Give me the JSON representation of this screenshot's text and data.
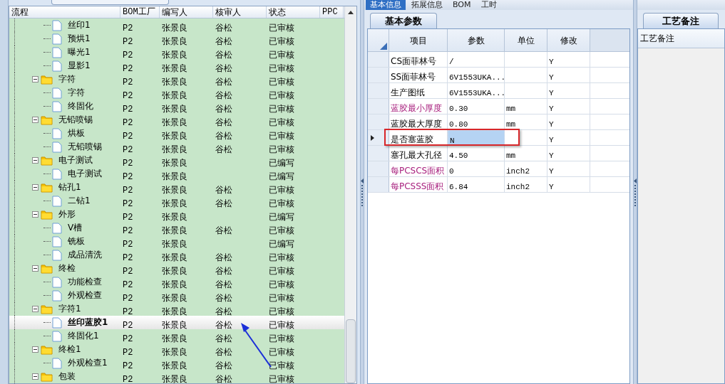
{
  "left_panel": {
    "columns": [
      "流程",
      "BOM工厂",
      "编写人",
      "核审人",
      "状态",
      "PPC"
    ],
    "rows": [
      {
        "kind": "leaf",
        "name": "丝印1",
        "bom": "P2",
        "writer": "张景良",
        "reviewer": "谷松",
        "status": "已审核",
        "selected": false
      },
      {
        "kind": "leaf",
        "name": "预烘1",
        "bom": "P2",
        "writer": "张景良",
        "reviewer": "谷松",
        "status": "已审核",
        "selected": false
      },
      {
        "kind": "leaf",
        "name": "曝光1",
        "bom": "P2",
        "writer": "张景良",
        "reviewer": "谷松",
        "status": "已审核",
        "selected": false
      },
      {
        "kind": "leaf",
        "name": "显影1",
        "bom": "P2",
        "writer": "张景良",
        "reviewer": "谷松",
        "status": "已审核",
        "selected": false
      },
      {
        "kind": "folder",
        "name": "字符",
        "bom": "P2",
        "writer": "张景良",
        "reviewer": "谷松",
        "status": "已审核",
        "selected": false,
        "expanded": true,
        "children": [
          {
            "kind": "leaf",
            "name": "字符",
            "bom": "P2",
            "writer": "张景良",
            "reviewer": "谷松",
            "status": "已审核",
            "selected": false
          },
          {
            "kind": "leaf",
            "name": "终固化",
            "bom": "P2",
            "writer": "张景良",
            "reviewer": "谷松",
            "status": "已审核",
            "selected": false
          }
        ]
      },
      {
        "kind": "folder",
        "name": "无铅喷锡",
        "bom": "P2",
        "writer": "张景良",
        "reviewer": "谷松",
        "status": "已审核",
        "selected": false,
        "expanded": true,
        "children": [
          {
            "kind": "leaf",
            "name": "烘板",
            "bom": "P2",
            "writer": "张景良",
            "reviewer": "谷松",
            "status": "已审核",
            "selected": false
          },
          {
            "kind": "leaf",
            "name": "无铅喷锡",
            "bom": "P2",
            "writer": "张景良",
            "reviewer": "谷松",
            "status": "已审核",
            "selected": false
          }
        ]
      },
      {
        "kind": "folder",
        "name": "电子测试",
        "bom": "P2",
        "writer": "张景良",
        "status": "已编写",
        "selected": false,
        "expanded": true,
        "children": [
          {
            "kind": "leaf",
            "name": "电子测试",
            "bom": "P2",
            "writer": "张景良",
            "status": "已编写",
            "selected": false
          }
        ]
      },
      {
        "kind": "folder",
        "name": "钻孔1",
        "bom": "P2",
        "writer": "张景良",
        "reviewer": "谷松",
        "status": "已审核",
        "selected": false,
        "expanded": true,
        "children": [
          {
            "kind": "leaf",
            "name": "二钻1",
            "bom": "P2",
            "writer": "张景良",
            "reviewer": "谷松",
            "status": "已审核",
            "selected": false
          }
        ]
      },
      {
        "kind": "folder",
        "name": "外形",
        "bom": "P2",
        "writer": "张景良",
        "status": "已编写",
        "selected": false,
        "expanded": true,
        "children": [
          {
            "kind": "leaf",
            "name": "V槽",
            "bom": "P2",
            "writer": "张景良",
            "reviewer": "谷松",
            "status": "已审核",
            "selected": false
          },
          {
            "kind": "leaf",
            "name": "铣板",
            "bom": "P2",
            "writer": "张景良",
            "status": "已编写",
            "selected": false
          },
          {
            "kind": "leaf",
            "name": "成品清洗",
            "bom": "P2",
            "writer": "张景良",
            "reviewer": "谷松",
            "status": "已审核",
            "selected": false
          }
        ]
      },
      {
        "kind": "folder",
        "name": "终检",
        "bom": "P2",
        "writer": "张景良",
        "reviewer": "谷松",
        "status": "已审核",
        "selected": false,
        "expanded": true,
        "children": [
          {
            "kind": "leaf",
            "name": "功能检查",
            "bom": "P2",
            "writer": "张景良",
            "reviewer": "谷松",
            "status": "已审核",
            "selected": false
          },
          {
            "kind": "leaf",
            "name": "外观检查",
            "bom": "P2",
            "writer": "张景良",
            "reviewer": "谷松",
            "status": "已审核",
            "selected": false
          }
        ]
      },
      {
        "kind": "folder",
        "name": "字符1",
        "bom": "P2",
        "writer": "张景良",
        "reviewer": "谷松",
        "status": "已审核",
        "selected": false,
        "expanded": true,
        "children": [
          {
            "kind": "leaf",
            "name": "丝印蓝胶1",
            "bom": "P2",
            "writer": "张景良",
            "reviewer": "谷松",
            "status": "已审核",
            "selected": true
          },
          {
            "kind": "leaf",
            "name": "终固化1",
            "bom": "P2",
            "writer": "张景良",
            "reviewer": "谷松",
            "status": "已审核",
            "selected": false
          }
        ]
      },
      {
        "kind": "folder",
        "name": "终检1",
        "bom": "P2",
        "writer": "张景良",
        "reviewer": "谷松",
        "status": "已审核",
        "selected": false,
        "expanded": true,
        "children": [
          {
            "kind": "leaf",
            "name": "外观检查1",
            "bom": "P2",
            "writer": "张景良",
            "reviewer": "谷松",
            "status": "已审核",
            "selected": false
          }
        ]
      },
      {
        "kind": "folder",
        "name": "包装",
        "bom": "P2",
        "writer": "张景良",
        "reviewer": "谷松",
        "status": "已审核",
        "selected": false,
        "expanded": true
      }
    ]
  },
  "detail_panel": {
    "tabs": [
      {
        "label": "基本信息",
        "selected": true
      },
      {
        "label": "拓展信息",
        "selected": false
      },
      {
        "label": "BOM",
        "selected": false
      },
      {
        "label": "工时",
        "selected": false
      }
    ],
    "subtab": "基本参数",
    "columns": [
      "项目",
      "参数",
      "单位",
      "修改"
    ],
    "rows": [
      {
        "item": "CS面菲林号",
        "value": "/",
        "modify": "Y",
        "emphasized": false,
        "selected": false
      },
      {
        "item": "SS面菲林号",
        "value": "6V1553UKA...",
        "modify": "Y",
        "emphasized": false,
        "selected": false
      },
      {
        "item": "生产图纸",
        "value": "6V1553UKA...",
        "modify": "Y",
        "emphasized": false,
        "selected": false
      },
      {
        "item": "蓝胶最小厚度",
        "value": "0.30",
        "unit": "mm",
        "modify": "Y",
        "emphasized": true,
        "selected": false
      },
      {
        "item": "蓝胶最大厚度",
        "value": "0.80",
        "unit": "mm",
        "modify": "Y",
        "emphasized": false,
        "selected": false
      },
      {
        "item": "是否塞蓝胶",
        "value": "N",
        "modify": "Y",
        "emphasized": false,
        "selected": true
      },
      {
        "item": "塞孔最大孔径",
        "value": "4.50",
        "unit": "mm",
        "modify": "Y",
        "emphasized": false,
        "selected": false
      },
      {
        "item": "每PCSCS面积",
        "value": "0",
        "unit": "inch2",
        "modify": "Y",
        "emphasized": true,
        "selected": false
      },
      {
        "item": "每PCSSS面积",
        "value": "6.84",
        "unit": "inch2",
        "modify": "Y",
        "emphasized": true,
        "selected": false
      }
    ]
  },
  "notes_panel": {
    "tab": "工艺备注",
    "header": "工艺备注"
  }
}
